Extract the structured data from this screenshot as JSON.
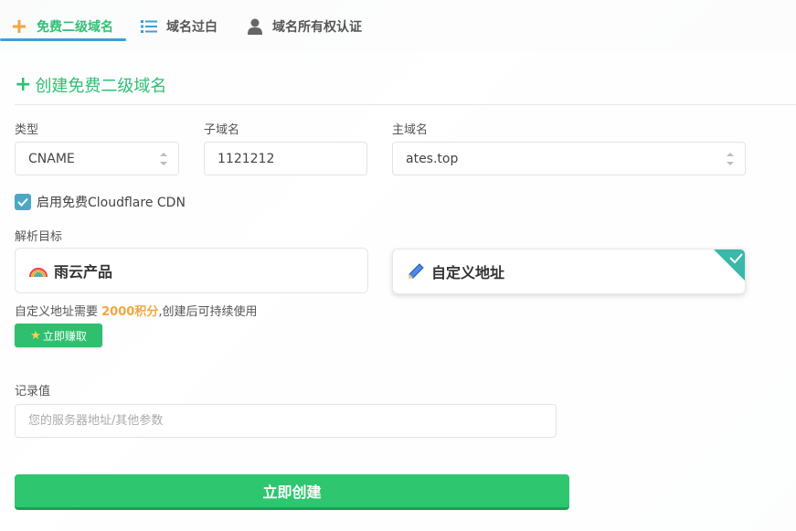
{
  "tabs": [
    {
      "label": "免费二级域名",
      "icon": "plus-icon",
      "active": true
    },
    {
      "label": "域名过白",
      "icon": "list-icon",
      "active": false
    },
    {
      "label": "域名所有权认证",
      "icon": "user-icon",
      "active": false
    }
  ],
  "card": {
    "title": "创建免费二级域名",
    "type_label": "类型",
    "type_value": "CNAME",
    "subdomain_label": "子域名",
    "subdomain_value": "1121212",
    "domain_label": "主域名",
    "domain_value": "ates.top",
    "cdn_label": "启用免费Cloudflare CDN",
    "cdn_checked": true,
    "target_label": "解析目标",
    "option_product": "雨云产品",
    "option_custom": "自定义地址",
    "note_prefix": "自定义地址需要 ",
    "note_points": "2000积分",
    "note_suffix": ",创建后可持续使用",
    "earn_button": "立即赚取",
    "record_label": "记录值",
    "record_placeholder": "您的服务器地址/其他参数",
    "create_button": "立即创建"
  },
  "colors": {
    "accent_green": "#2fbf73",
    "points_orange": "#f2a641",
    "checkbox_blue": "#4aa8c5",
    "tab_underline": "#3aa0d8"
  }
}
